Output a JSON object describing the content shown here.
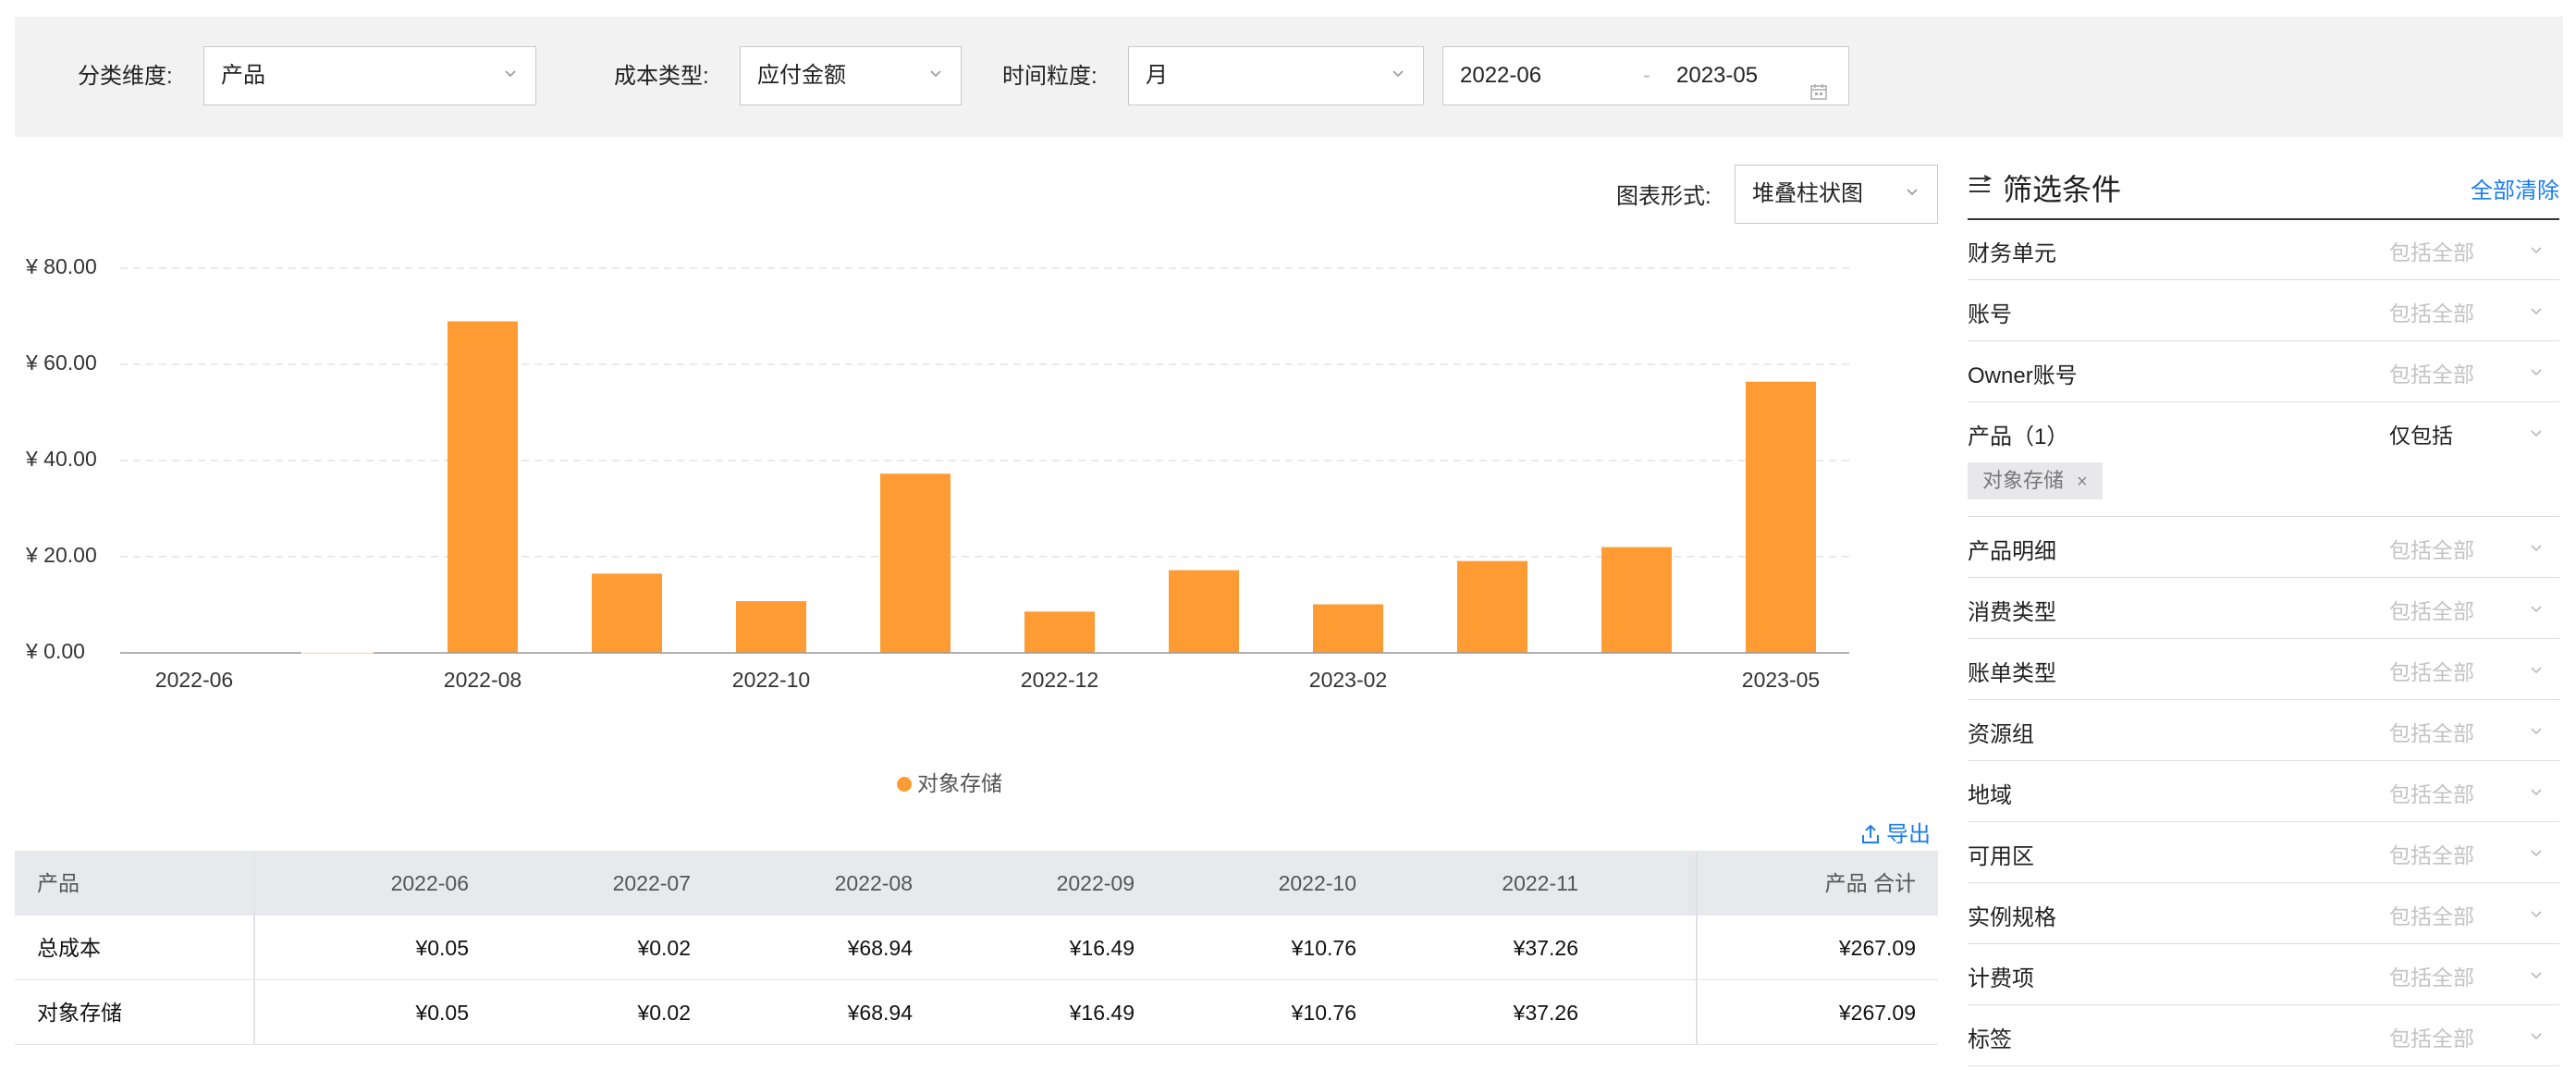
{
  "toolbar": {
    "category_label": "分类维度:",
    "category_value": "产品",
    "cost_type_label": "成本类型:",
    "cost_type_value": "应付金额",
    "granularity_label": "时间粒度:",
    "granularity_value": "月",
    "date_start": "2022-06",
    "date_separator": "-",
    "date_end": "2023-05"
  },
  "chart_controls": {
    "chart_type_label": "图表形式:",
    "chart_type_value": "堆叠柱状图"
  },
  "chart_data": {
    "type": "bar",
    "stacked": true,
    "categories": [
      "2022-06",
      "2022-07",
      "2022-08",
      "2022-09",
      "2022-10",
      "2022-11",
      "2022-12",
      "2023-01",
      "2023-02",
      "2023-03",
      "2023-04",
      "2023-05"
    ],
    "series": [
      {
        "name": "对象存储",
        "values": [
          0.05,
          0.02,
          68.94,
          16.49,
          10.76,
          37.26,
          8.6,
          17.2,
          10.1,
          19.1,
          22.0,
          56.4
        ],
        "color": "#fe9c33"
      }
    ],
    "y_tick_labels": [
      "¥ 0.00",
      "¥ 20.00",
      "¥ 40.00",
      "¥ 60.00",
      "¥ 80.00"
    ],
    "y_ticks": [
      0,
      20,
      40,
      60,
      80
    ],
    "ylim": [
      0,
      80
    ],
    "x_tick_labels": [
      "2022-06",
      "2022-08",
      "2022-10",
      "2022-12",
      "2023-02",
      "2023-05"
    ],
    "grid": "horizontal dashed",
    "legend_position": "bottom-center"
  },
  "export_label": "导出",
  "table": {
    "columns": [
      "产品",
      "2022-06",
      "2022-07",
      "2022-08",
      "2022-09",
      "2022-10",
      "2022-11",
      "产品 合计"
    ],
    "rows": [
      {
        "name": "总成本",
        "values": [
          "¥0.05",
          "¥0.02",
          "¥68.94",
          "¥16.49",
          "¥10.76",
          "¥37.26"
        ],
        "total": "¥267.09"
      },
      {
        "name": "对象存储",
        "values": [
          "¥0.05",
          "¥0.02",
          "¥68.94",
          "¥16.49",
          "¥10.76",
          "¥37.26"
        ],
        "total": "¥267.09"
      }
    ]
  },
  "filters": {
    "title": "筛选条件",
    "clear_all": "全部清除",
    "accent_color": "#1a7df0",
    "items": [
      {
        "label": "财务单元",
        "value": "包括全部"
      },
      {
        "label": "账号",
        "value": "包括全部"
      },
      {
        "label": "Owner账号",
        "value": "包括全部"
      },
      {
        "label": "产品（1）",
        "value": "仅包括",
        "tag": "对象存储"
      },
      {
        "label": "产品明细",
        "value": "包括全部"
      },
      {
        "label": "消费类型",
        "value": "包括全部"
      },
      {
        "label": "账单类型",
        "value": "包括全部"
      },
      {
        "label": "资源组",
        "value": "包括全部"
      },
      {
        "label": "地域",
        "value": "包括全部"
      },
      {
        "label": "可用区",
        "value": "包括全部"
      },
      {
        "label": "实例规格",
        "value": "包括全部"
      },
      {
        "label": "计费项",
        "value": "包括全部"
      },
      {
        "label": "标签",
        "value": "包括全部"
      }
    ]
  }
}
